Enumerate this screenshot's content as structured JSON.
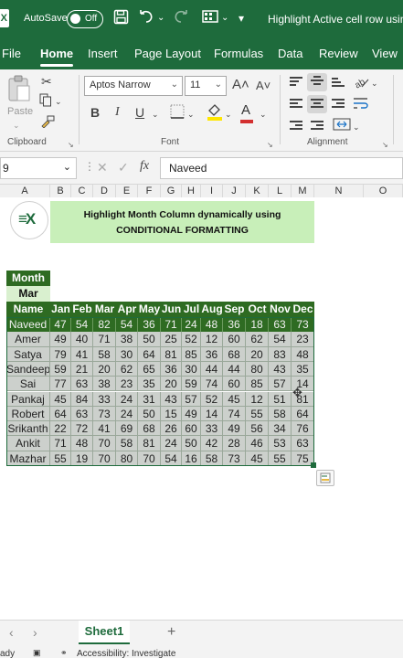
{
  "titlebar": {
    "logo_letter": "X",
    "autosave_label": "AutoSave",
    "toggle_state": "Off",
    "doc_title": "Highlight Active cell row using"
  },
  "menu": {
    "tabs": [
      "File",
      "Home",
      "Insert",
      "Page Layout",
      "Formulas",
      "Data",
      "Review",
      "View"
    ],
    "active": "Home"
  },
  "ribbon": {
    "paste_label": "Paste",
    "clipboard_label": "Clipboard",
    "font_name": "Aptos Narrow",
    "font_size": "11",
    "font_label": "Font",
    "alignment_label": "Alignment",
    "bold": "B",
    "italic": "I",
    "underline": "U",
    "grow_font": "A˄",
    "shrink_font": "A˅",
    "font_color_letter": "A",
    "font_color": "#d32f2f",
    "highlight_color": "#ffe600"
  },
  "formula_bar": {
    "name_box": "9",
    "fx": "fx",
    "value": "Naveed"
  },
  "sheet": {
    "columns": [
      "A",
      "B",
      "C",
      "D",
      "E",
      "F",
      "G",
      "H",
      "I",
      "J",
      "K",
      "L",
      "M",
      "N",
      "O"
    ],
    "banner_line1": "Highlight Month Column dynamically using",
    "banner_line2": "CONDITIONAL FORMATTING",
    "month_label": "Month",
    "month_value": "Mar",
    "name_header": "Name",
    "months": [
      "Jan",
      "Feb",
      "Mar",
      "Apr",
      "May",
      "Jun",
      "Jul",
      "Aug",
      "Sep",
      "Oct",
      "Nov",
      "Dec"
    ],
    "rows": [
      {
        "name": "Naveed",
        "values": [
          47,
          54,
          82,
          54,
          36,
          71,
          24,
          48,
          36,
          18,
          63,
          73
        ]
      },
      {
        "name": "Amer",
        "values": [
          49,
          40,
          71,
          38,
          50,
          25,
          52,
          12,
          60,
          62,
          54,
          23
        ]
      },
      {
        "name": "Satya",
        "values": [
          79,
          41,
          58,
          30,
          64,
          81,
          85,
          36,
          68,
          20,
          83,
          48
        ]
      },
      {
        "name": "Sandeep",
        "values": [
          59,
          21,
          20,
          62,
          65,
          36,
          30,
          44,
          44,
          80,
          43,
          35
        ]
      },
      {
        "name": "Sai",
        "values": [
          77,
          63,
          38,
          23,
          35,
          20,
          59,
          74,
          60,
          85,
          57,
          14
        ]
      },
      {
        "name": "Pankaj",
        "values": [
          45,
          84,
          33,
          24,
          31,
          43,
          57,
          52,
          45,
          12,
          51,
          81
        ]
      },
      {
        "name": "Robert",
        "values": [
          64,
          63,
          73,
          24,
          50,
          15,
          49,
          14,
          74,
          55,
          58,
          64
        ]
      },
      {
        "name": "Srikanth",
        "values": [
          22,
          72,
          41,
          69,
          68,
          26,
          60,
          33,
          49,
          56,
          34,
          76
        ]
      },
      {
        "name": "Ankit",
        "values": [
          71,
          48,
          70,
          58,
          81,
          24,
          50,
          42,
          28,
          46,
          53,
          63
        ]
      },
      {
        "name": "Mazhar",
        "values": [
          55,
          19,
          70,
          80,
          70,
          54,
          16,
          58,
          73,
          45,
          55,
          75
        ]
      }
    ],
    "highlight_color": "#2e6b22"
  },
  "bottom": {
    "sheet_tab": "Sheet1",
    "add_sheet": "+",
    "status_ready": "ady",
    "status_accessibility": "Accessibility: Investigate"
  }
}
